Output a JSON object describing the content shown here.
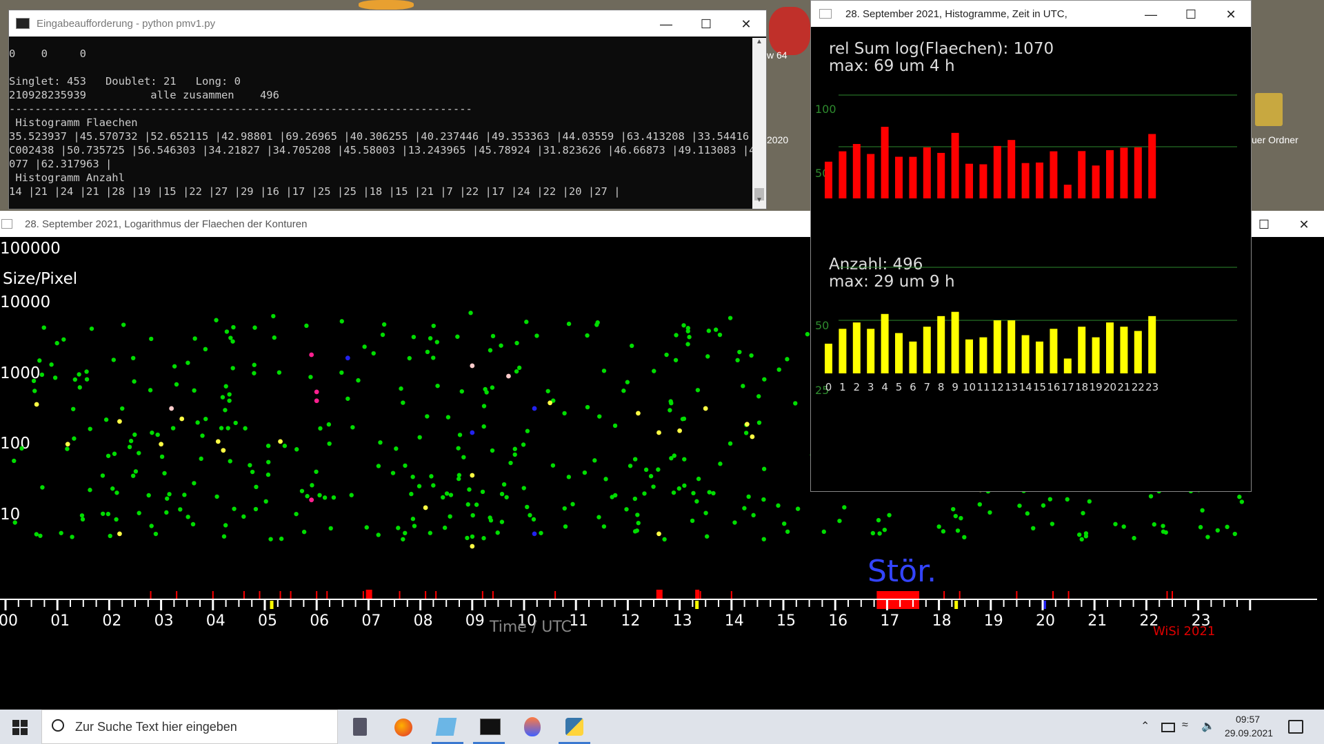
{
  "colors": {
    "cmd_bg": "#0c0c0c",
    "cmd_text": "#cccccc",
    "plot_bg": "#000000",
    "point_normal": "#00dd00",
    "point_yellow": "#ffff44",
    "point_magenta": "#ff2090",
    "point_blue": "#2222ee",
    "point_pink": "#ffcccc",
    "bar_red": "#ff0000",
    "bar_yellow": "#ffff00",
    "gridline_green": "#2e8b2e",
    "stoer_blue": "#3344ff"
  },
  "desktop": {
    "icon_label_1": "w 64",
    "icon_label_2": "2020",
    "icon_label_3": "uer Ordner"
  },
  "cmd_window": {
    "title": "Eingabeaufforderung - python  pmv1.py",
    "lines": [
      "0    0     0",
      "",
      "Singlet: 453   Doublet: 21   Long: 0",
      "210928235939          alle zusammen    496",
      "------------------------------------------------------------------------",
      " Histogramm Flaechen",
      "35.523937 |45.570732 |52.652115 |42.98801 |69.26965 |40.306255 |40.237446 |49.353363 |44.03559 |63.413208 |33.54416 |33.",
      "C002438 |50.735725 |56.546303 |34.21827 |34.705208 |45.58003 |13.243965 |45.78924 |31.823626 |46.66873 |49.113083 |49.415",
      "077 |62.317963 |",
      " Histogramm Anzahl",
      "14 |21 |24 |21 |28 |19 |15 |22 |27 |29 |16 |17 |25 |25 |18 |15 |21 |7 |22 |17 |24 |22 |20 |27 |"
    ]
  },
  "scatter_window": {
    "title": "28. September 2021, Logarithmus der Flaechen der Konturen",
    "y_tick_labels": [
      "100000",
      "10000",
      "1000",
      "100",
      "10"
    ],
    "y_axis_label": "Size/Pixel",
    "x_tick_labels": [
      "00",
      "01",
      "02",
      "03",
      "04",
      "05",
      "06",
      "07",
      "08",
      "09",
      "10",
      "11",
      "12",
      "13",
      "14",
      "15",
      "16",
      "17",
      "18",
      "19",
      "20",
      "21",
      "22",
      "23"
    ],
    "x_axis_label": "Time  /  UTC",
    "stoer_label": "Stör.",
    "signature": "WiSi 2021"
  },
  "hist_window": {
    "title": "28. September 2021, Histogramme, Zeit in UTC,",
    "top_line1": "rel Sum log(Flaechen): 1070",
    "top_line2": "max: 69 um 4 h",
    "top_tick_100": "100",
    "top_tick_50": "50",
    "bottom_line1": "Anzahl: 496",
    "bottom_line2": "max: 29 um 9 h",
    "bottom_tick_50": "50",
    "bottom_tick_25": "25",
    "hour_labels": [
      "0",
      "1",
      "2",
      "3",
      "4",
      "5",
      "6",
      "7",
      "8",
      "9",
      "10",
      "11",
      "12",
      "13",
      "14",
      "15",
      "16",
      "17",
      "18",
      "19",
      "20",
      "21",
      "22",
      "23"
    ]
  },
  "chart_data": [
    {
      "type": "bar",
      "title": "rel Sum log(Flaechen): 1070",
      "categories": [
        "0",
        "1",
        "2",
        "3",
        "4",
        "5",
        "6",
        "7",
        "8",
        "9",
        "10",
        "11",
        "12",
        "13",
        "14",
        "15",
        "16",
        "17",
        "18",
        "19",
        "20",
        "21",
        "22",
        "23"
      ],
      "values": [
        35.523937,
        45.570732,
        52.652115,
        42.98801,
        69.26965,
        40.306255,
        40.237446,
        49.353363,
        44.03559,
        63.413208,
        33.54416,
        33.002438,
        50.735725,
        56.546303,
        34.21827,
        34.705208,
        45.58003,
        13.243965,
        45.78924,
        31.823626,
        46.66873,
        49.113083,
        49.415077,
        62.317963
      ],
      "ylim": [
        0,
        100
      ],
      "grid": true,
      "color": "#ff0000"
    },
    {
      "type": "bar",
      "title": "Anzahl: 496",
      "categories": [
        "0",
        "1",
        "2",
        "3",
        "4",
        "5",
        "6",
        "7",
        "8",
        "9",
        "10",
        "11",
        "12",
        "13",
        "14",
        "15",
        "16",
        "17",
        "18",
        "19",
        "20",
        "21",
        "22",
        "23"
      ],
      "values": [
        14,
        21,
        24,
        21,
        28,
        19,
        15,
        22,
        27,
        29,
        16,
        17,
        25,
        25,
        18,
        15,
        21,
        7,
        22,
        17,
        24,
        22,
        20,
        27
      ],
      "ylim": [
        0,
        50
      ],
      "grid": true,
      "color": "#ffff00"
    },
    {
      "type": "scatter",
      "title": "28. September 2021, Logarithmus der Flaechen der Konturen",
      "xlabel": "Time  /  UTC",
      "ylabel": "Size/Pixel",
      "xlim": [
        0,
        24
      ],
      "ylim": [
        3,
        100000
      ],
      "log_y": true,
      "points_yellow": [
        [
          0.6,
          400
        ],
        [
          1.2,
          110
        ],
        [
          2.2,
          230
        ],
        [
          3.0,
          110
        ],
        [
          3.4,
          250
        ],
        [
          4.1,
          120
        ],
        [
          4.2,
          90
        ],
        [
          5.3,
          120
        ],
        [
          10.5,
          420
        ],
        [
          12.2,
          300
        ],
        [
          12.6,
          160
        ],
        [
          13.0,
          170
        ],
        [
          13.5,
          350
        ],
        [
          14.3,
          210
        ],
        [
          14.4,
          140
        ],
        [
          9.0,
          40
        ],
        [
          8.1,
          14
        ],
        [
          12.6,
          6
        ],
        [
          2.2,
          6
        ],
        [
          9.0,
          4
        ],
        [
          16.5,
          30
        ],
        [
          18.8,
          25
        ]
      ],
      "points_magenta": [
        [
          5.9,
          2000
        ],
        [
          6.0,
          600
        ],
        [
          6.0,
          450
        ],
        [
          5.9,
          18
        ]
      ],
      "points_blue": [
        [
          6.6,
          1800
        ],
        [
          9.0,
          160
        ],
        [
          10.2,
          350
        ],
        [
          10.2,
          6
        ]
      ],
      "points_pink": [
        [
          3.2,
          350
        ],
        [
          9.0,
          1400
        ],
        [
          9.7,
          1000
        ]
      ]
    }
  ],
  "taskbar": {
    "search_placeholder": "Zur Suche Text hier eingeben",
    "time": "09:57",
    "date": "29.09.2021"
  }
}
